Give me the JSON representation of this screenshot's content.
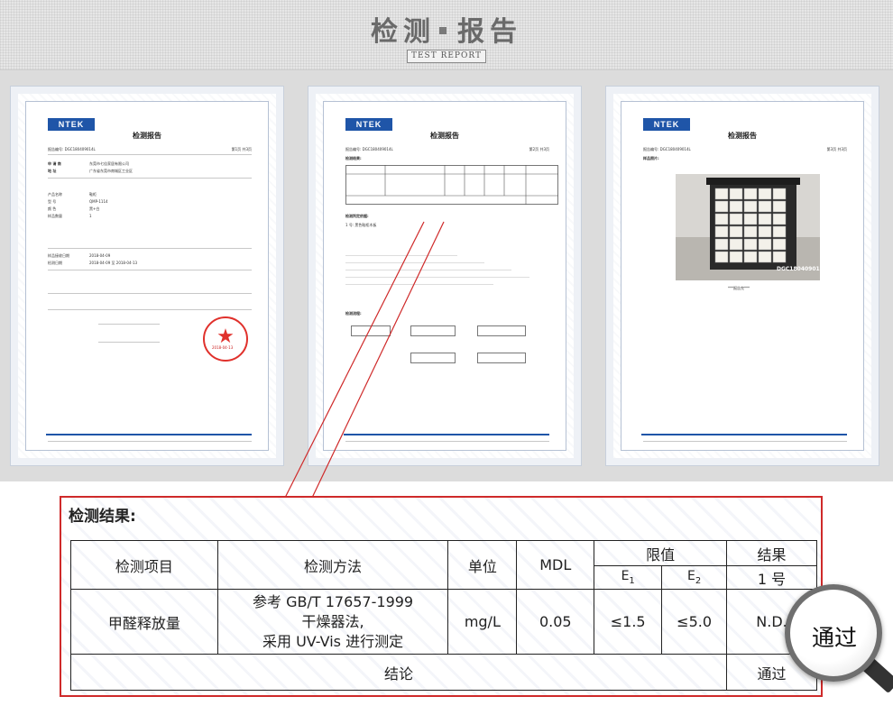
{
  "header": {
    "title_a": "检测",
    "title_b": "报告",
    "subtitle": "TEST REPORT"
  },
  "pages": [
    {
      "logo": "NTEK",
      "title": "检测报告",
      "report_no": "报告编号: DGC180409014L",
      "page_no": "第1页 共3页",
      "rows": [
        {
          "k": "申 请 商",
          "v": "东莞市七佳家居有限公司"
        },
        {
          "k": "地    址",
          "v": "广东省东莞市南城区工业区"
        },
        {
          "k": "产品名称",
          "v": "鞋柜"
        },
        {
          "k": "型    号",
          "v": "QMP-1114"
        },
        {
          "k": "颜    色",
          "v": "黑+白"
        },
        {
          "k": "样品数量",
          "v": "1"
        }
      ],
      "dates": [
        {
          "k": "样品接收日期",
          "v": "2018-04-09"
        },
        {
          "k": "检测日期",
          "v": "2018-04-09 至 2018-04-13"
        }
      ],
      "seal_date": "2018-04-13"
    },
    {
      "logo": "NTEK",
      "title": "检测报告",
      "report_no": "报告编号: DGC180409014L",
      "page_no": "第2页 共3页",
      "section1": "检测结果:",
      "section2": "检测判定依据:",
      "section3": "检测流程:",
      "note1": "1 号: 黑色鞋柜木板"
    },
    {
      "logo": "NTEK",
      "title": "检测报告",
      "report_no": "报告编号: DGC180409014L",
      "page_no": "第3页 共3页",
      "section1": "样品照片:",
      "photo_tag": "DGC180409014",
      "caption": "***报告完***"
    }
  ],
  "results": {
    "heading": "检测结果:",
    "col_item": "检测项目",
    "col_method": "检测方法",
    "col_unit": "单位",
    "col_mdl": "MDL",
    "col_limit": "限值",
    "col_result": "结果",
    "e1": "E",
    "e1_sub": "1",
    "e2": "E",
    "e2_sub": "2",
    "sample": "1 号",
    "row": {
      "item": "甲醛释放量",
      "method": [
        "参考 GB/T 17657-1999",
        "干燥器法,",
        "采用 UV-Vis 进行测定"
      ],
      "unit": "mg/L",
      "mdl": "0.05",
      "e1": "≤1.5",
      "e2": "≤5.0",
      "result": "N.D."
    },
    "conclusion_label": "结论",
    "conclusion_value": "通过"
  },
  "magnifier_text": "通过",
  "colors": {
    "accent_red": "#cf2a2a",
    "logo_blue": "#1f55a8"
  }
}
